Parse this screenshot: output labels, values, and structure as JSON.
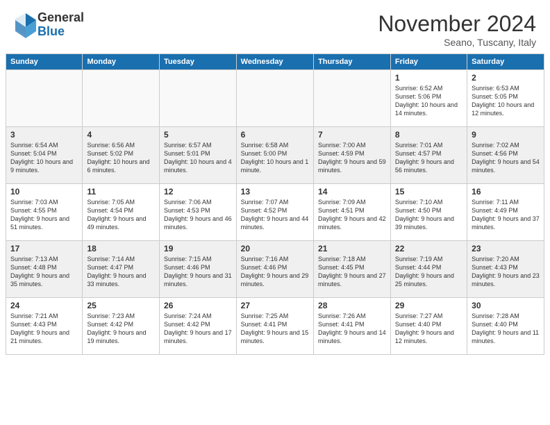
{
  "header": {
    "logo_line1": "General",
    "logo_line2": "Blue",
    "month": "November 2024",
    "location": "Seano, Tuscany, Italy"
  },
  "weekdays": [
    "Sunday",
    "Monday",
    "Tuesday",
    "Wednesday",
    "Thursday",
    "Friday",
    "Saturday"
  ],
  "weeks": [
    [
      {
        "day": "",
        "info": ""
      },
      {
        "day": "",
        "info": ""
      },
      {
        "day": "",
        "info": ""
      },
      {
        "day": "",
        "info": ""
      },
      {
        "day": "",
        "info": ""
      },
      {
        "day": "1",
        "info": "Sunrise: 6:52 AM\nSunset: 5:06 PM\nDaylight: 10 hours and 14 minutes."
      },
      {
        "day": "2",
        "info": "Sunrise: 6:53 AM\nSunset: 5:05 PM\nDaylight: 10 hours and 12 minutes."
      }
    ],
    [
      {
        "day": "3",
        "info": "Sunrise: 6:54 AM\nSunset: 5:04 PM\nDaylight: 10 hours and 9 minutes."
      },
      {
        "day": "4",
        "info": "Sunrise: 6:56 AM\nSunset: 5:02 PM\nDaylight: 10 hours and 6 minutes."
      },
      {
        "day": "5",
        "info": "Sunrise: 6:57 AM\nSunset: 5:01 PM\nDaylight: 10 hours and 4 minutes."
      },
      {
        "day": "6",
        "info": "Sunrise: 6:58 AM\nSunset: 5:00 PM\nDaylight: 10 hours and 1 minute."
      },
      {
        "day": "7",
        "info": "Sunrise: 7:00 AM\nSunset: 4:59 PM\nDaylight: 9 hours and 59 minutes."
      },
      {
        "day": "8",
        "info": "Sunrise: 7:01 AM\nSunset: 4:57 PM\nDaylight: 9 hours and 56 minutes."
      },
      {
        "day": "9",
        "info": "Sunrise: 7:02 AM\nSunset: 4:56 PM\nDaylight: 9 hours and 54 minutes."
      }
    ],
    [
      {
        "day": "10",
        "info": "Sunrise: 7:03 AM\nSunset: 4:55 PM\nDaylight: 9 hours and 51 minutes."
      },
      {
        "day": "11",
        "info": "Sunrise: 7:05 AM\nSunset: 4:54 PM\nDaylight: 9 hours and 49 minutes."
      },
      {
        "day": "12",
        "info": "Sunrise: 7:06 AM\nSunset: 4:53 PM\nDaylight: 9 hours and 46 minutes."
      },
      {
        "day": "13",
        "info": "Sunrise: 7:07 AM\nSunset: 4:52 PM\nDaylight: 9 hours and 44 minutes."
      },
      {
        "day": "14",
        "info": "Sunrise: 7:09 AM\nSunset: 4:51 PM\nDaylight: 9 hours and 42 minutes."
      },
      {
        "day": "15",
        "info": "Sunrise: 7:10 AM\nSunset: 4:50 PM\nDaylight: 9 hours and 39 minutes."
      },
      {
        "day": "16",
        "info": "Sunrise: 7:11 AM\nSunset: 4:49 PM\nDaylight: 9 hours and 37 minutes."
      }
    ],
    [
      {
        "day": "17",
        "info": "Sunrise: 7:13 AM\nSunset: 4:48 PM\nDaylight: 9 hours and 35 minutes."
      },
      {
        "day": "18",
        "info": "Sunrise: 7:14 AM\nSunset: 4:47 PM\nDaylight: 9 hours and 33 minutes."
      },
      {
        "day": "19",
        "info": "Sunrise: 7:15 AM\nSunset: 4:46 PM\nDaylight: 9 hours and 31 minutes."
      },
      {
        "day": "20",
        "info": "Sunrise: 7:16 AM\nSunset: 4:46 PM\nDaylight: 9 hours and 29 minutes."
      },
      {
        "day": "21",
        "info": "Sunrise: 7:18 AM\nSunset: 4:45 PM\nDaylight: 9 hours and 27 minutes."
      },
      {
        "day": "22",
        "info": "Sunrise: 7:19 AM\nSunset: 4:44 PM\nDaylight: 9 hours and 25 minutes."
      },
      {
        "day": "23",
        "info": "Sunrise: 7:20 AM\nSunset: 4:43 PM\nDaylight: 9 hours and 23 minutes."
      }
    ],
    [
      {
        "day": "24",
        "info": "Sunrise: 7:21 AM\nSunset: 4:43 PM\nDaylight: 9 hours and 21 minutes."
      },
      {
        "day": "25",
        "info": "Sunrise: 7:23 AM\nSunset: 4:42 PM\nDaylight: 9 hours and 19 minutes."
      },
      {
        "day": "26",
        "info": "Sunrise: 7:24 AM\nSunset: 4:42 PM\nDaylight: 9 hours and 17 minutes."
      },
      {
        "day": "27",
        "info": "Sunrise: 7:25 AM\nSunset: 4:41 PM\nDaylight: 9 hours and 15 minutes."
      },
      {
        "day": "28",
        "info": "Sunrise: 7:26 AM\nSunset: 4:41 PM\nDaylight: 9 hours and 14 minutes."
      },
      {
        "day": "29",
        "info": "Sunrise: 7:27 AM\nSunset: 4:40 PM\nDaylight: 9 hours and 12 minutes."
      },
      {
        "day": "30",
        "info": "Sunrise: 7:28 AM\nSunset: 4:40 PM\nDaylight: 9 hours and 11 minutes."
      }
    ]
  ]
}
